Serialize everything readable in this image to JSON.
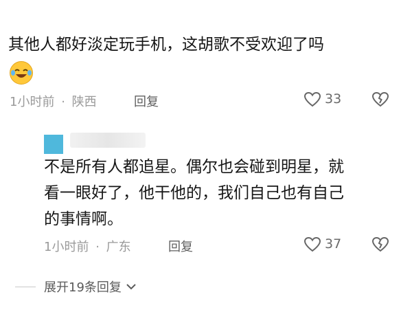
{
  "comment1": {
    "text": "其他人都好淡定玩手机，这胡歌不受欢迎了吗",
    "emoji": "laughing-tears-emoji",
    "time": "1小时前",
    "sep": "·",
    "location": "陕西",
    "reply_label": "回复",
    "like_count": "33"
  },
  "comment2": {
    "line1": "不是所有人都追星。偶尔也会碰到明星，就",
    "line2": "看一眼好了，他干他的，我们自己也有自己",
    "line3": "的事情啊。",
    "time": "1小时前",
    "sep": "·",
    "location": "广东",
    "reply_label": "回复",
    "like_count": "37"
  },
  "expand": {
    "label": "展开19条回复"
  },
  "colors": {
    "avatar": "#4fb8dc",
    "emoji": "#ffc83a"
  }
}
